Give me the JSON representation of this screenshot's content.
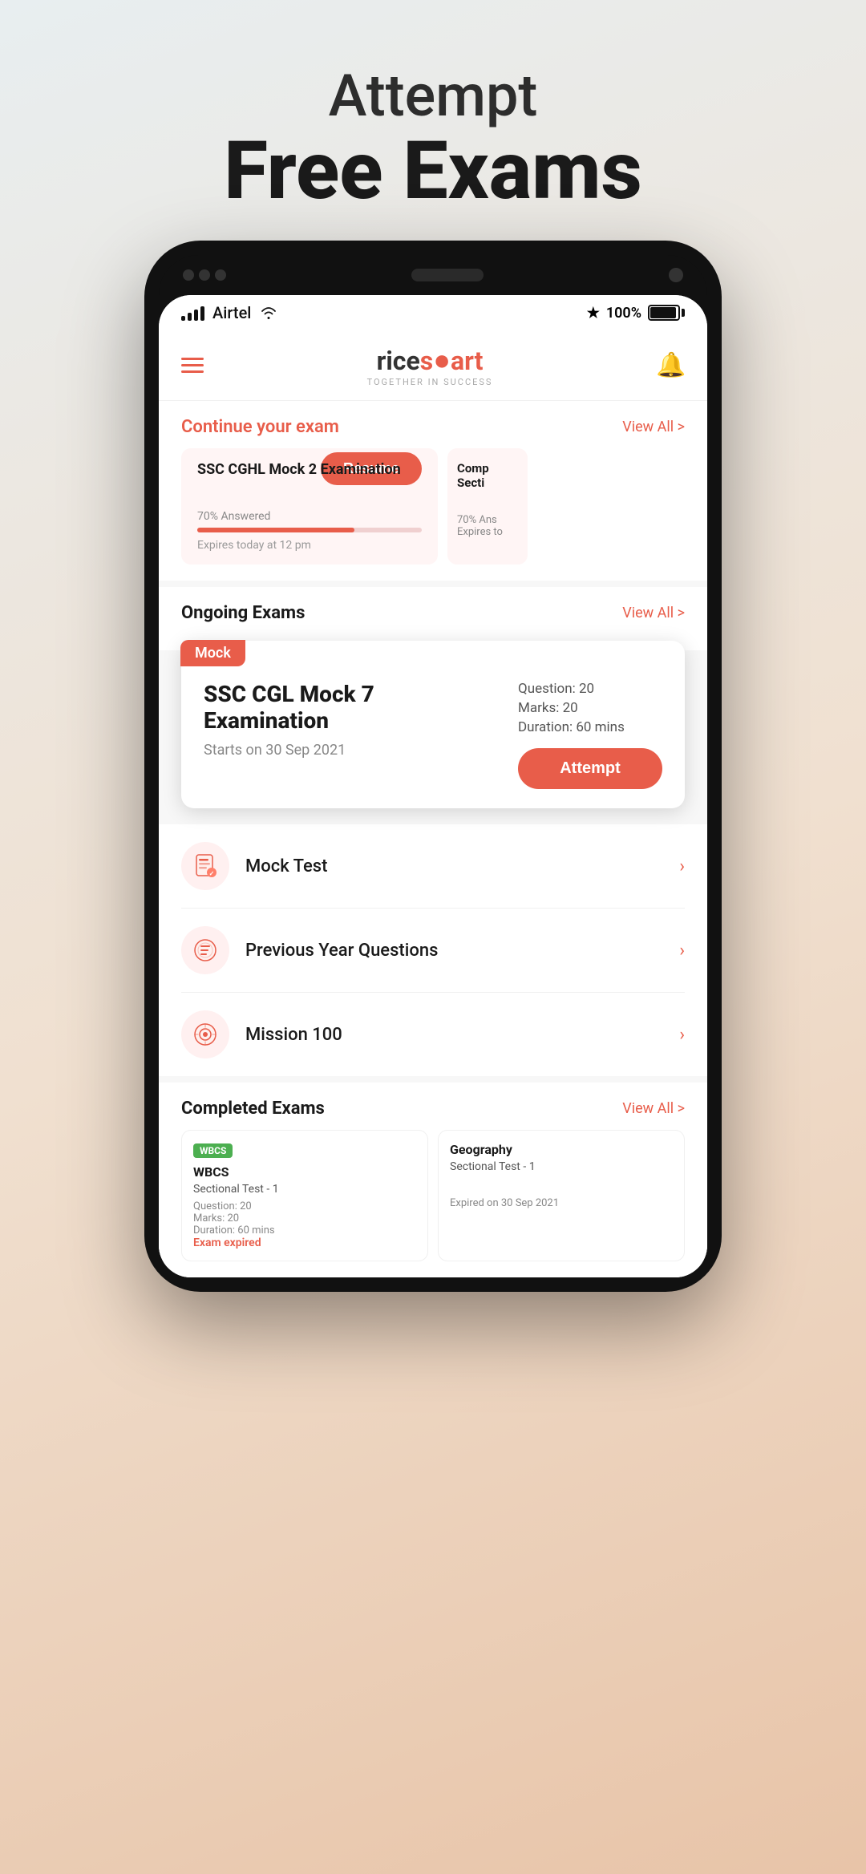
{
  "hero": {
    "line1": "Attempt",
    "line2": "Free Exams"
  },
  "statusBar": {
    "carrier": "Airtel",
    "battery": "100%"
  },
  "appHeader": {
    "logoRice": "rice",
    "logoSmart": "smart",
    "logoTagline": "TOGETHER IN SUCCESS"
  },
  "continueSection": {
    "title": "Continue your exam",
    "viewAll": "View All >",
    "card1": {
      "title": "SSC CGHL Mock 2 Examination",
      "answeredText": "70% Answered",
      "progressPercent": 70,
      "expiresText": "Expires today at 12 pm",
      "resumeLabel": "Resume"
    },
    "card2": {
      "titleLine1": "Comp",
      "titleLine2": "Secti",
      "answeredText": "70% Ans",
      "expiresText": "Expires to"
    }
  },
  "ongoingSection": {
    "title": "Ongoing Exams",
    "viewAll": "View All >"
  },
  "mockCard": {
    "badge": "Mock",
    "title": "SSC CGL Mock 7 Examination",
    "date": "Starts on 30 Sep 2021",
    "question": "Question: 20",
    "marks": "Marks: 20",
    "duration": "Duration: 60 mins",
    "attemptLabel": "Attempt"
  },
  "menuItems": [
    {
      "id": "mock-test",
      "label": "Mock Test",
      "icon": "📋"
    },
    {
      "id": "previous-year",
      "label": "Previous Year Questions",
      "icon": "📖"
    },
    {
      "id": "mission-100",
      "label": "Mission 100",
      "icon": "🎯"
    }
  ],
  "completedSection": {
    "title": "Completed Exams",
    "viewAll": "View All >",
    "card1": {
      "badge": "WBCS",
      "title": "WBCS",
      "subtitle": "Sectional Test - 1",
      "question": "Question: 20",
      "marks": "Marks: 20",
      "duration": "Duration: 60 mins",
      "status": "Exam expired"
    },
    "card2": {
      "title": "Geography",
      "subtitle": "Sectional Test - 1",
      "status": "Expired on 30 Sep 2021"
    }
  }
}
